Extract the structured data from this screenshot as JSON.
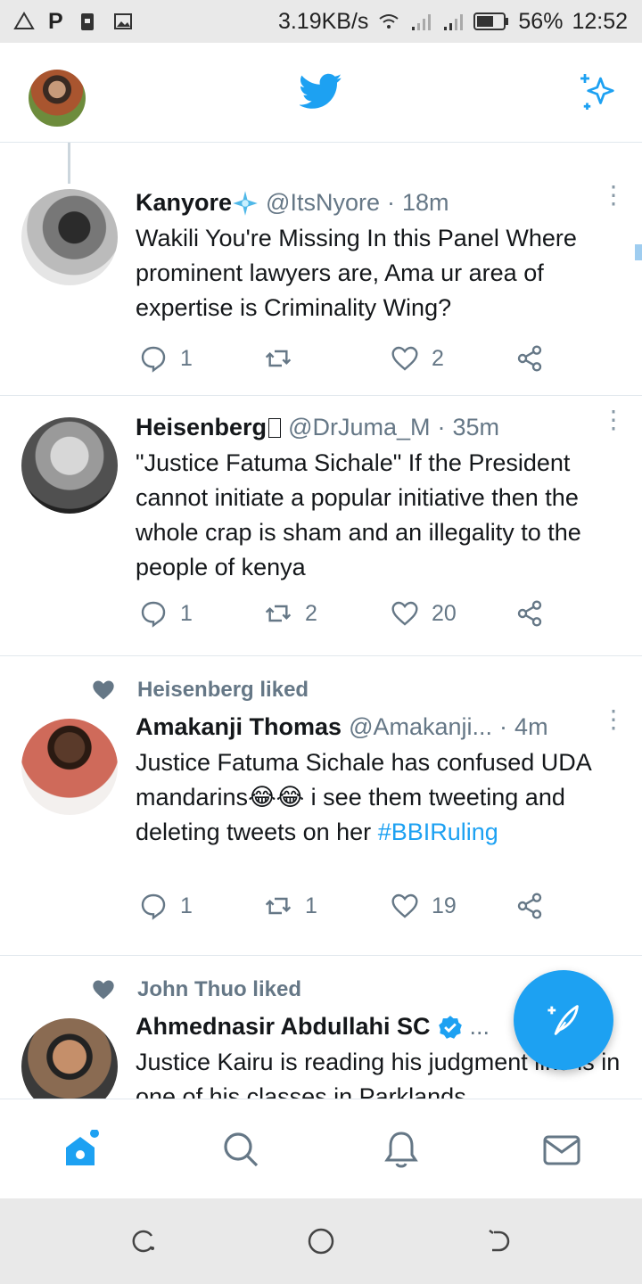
{
  "status_bar": {
    "left_icons": [
      "warning-icon",
      "parking-icon",
      "lock-icon",
      "image-icon"
    ],
    "left_letter": "P",
    "speed": "3.19KB/s",
    "battery": "56%",
    "time": "12:52"
  },
  "header": {
    "logo": "twitter-bird-icon",
    "sparkle": "sparkle-icon"
  },
  "tweets": [
    {
      "name": "Kanyore",
      "handle": "@ItsNyore",
      "dot": "·",
      "time": "18m",
      "text": "Wakili You're Missing In this Panel Where prominent lawyers are, Ama ur area of expertise is Criminality Wing?",
      "replies": "1",
      "retweets": "",
      "likes": "2"
    },
    {
      "name": "Heisenberg",
      "handle": "@DrJuma_M",
      "dot": "·",
      "time": "35m",
      "text": "\"Justice Fatuma Sichale\" If the President cannot initiate a popular initiative then the whole crap is sham and an illegality to the people of kenya",
      "replies": "1",
      "retweets": "2",
      "likes": "20"
    },
    {
      "liked_by": "Heisenberg liked",
      "name": "Amakanji Thomas",
      "handle": "@Amakanji...",
      "dot": "·",
      "time": "4m",
      "text_before": "Justice Fatuma Sichale has confused UDA mandarins",
      "text_emoji": "😂😂",
      "text_after": " i see them tweeting and deleting tweets on her ",
      "hashtag": "#BBIRuling",
      "replies": "1",
      "retweets": "1",
      "likes": "19"
    },
    {
      "liked_by": "John Thuo liked",
      "name": "Ahmednasir Abdullahi SC",
      "ellipsis": "...",
      "text": "Justice Kairu is reading his judgment like is in one of his classes in Parklands"
    }
  ],
  "bottom_nav": [
    "home-icon",
    "search-icon",
    "notifications-icon",
    "messages-icon"
  ],
  "colors": {
    "accent": "#1da1f2",
    "text": "#14171a",
    "secondary": "#657786",
    "divider": "#e1e8ed"
  }
}
